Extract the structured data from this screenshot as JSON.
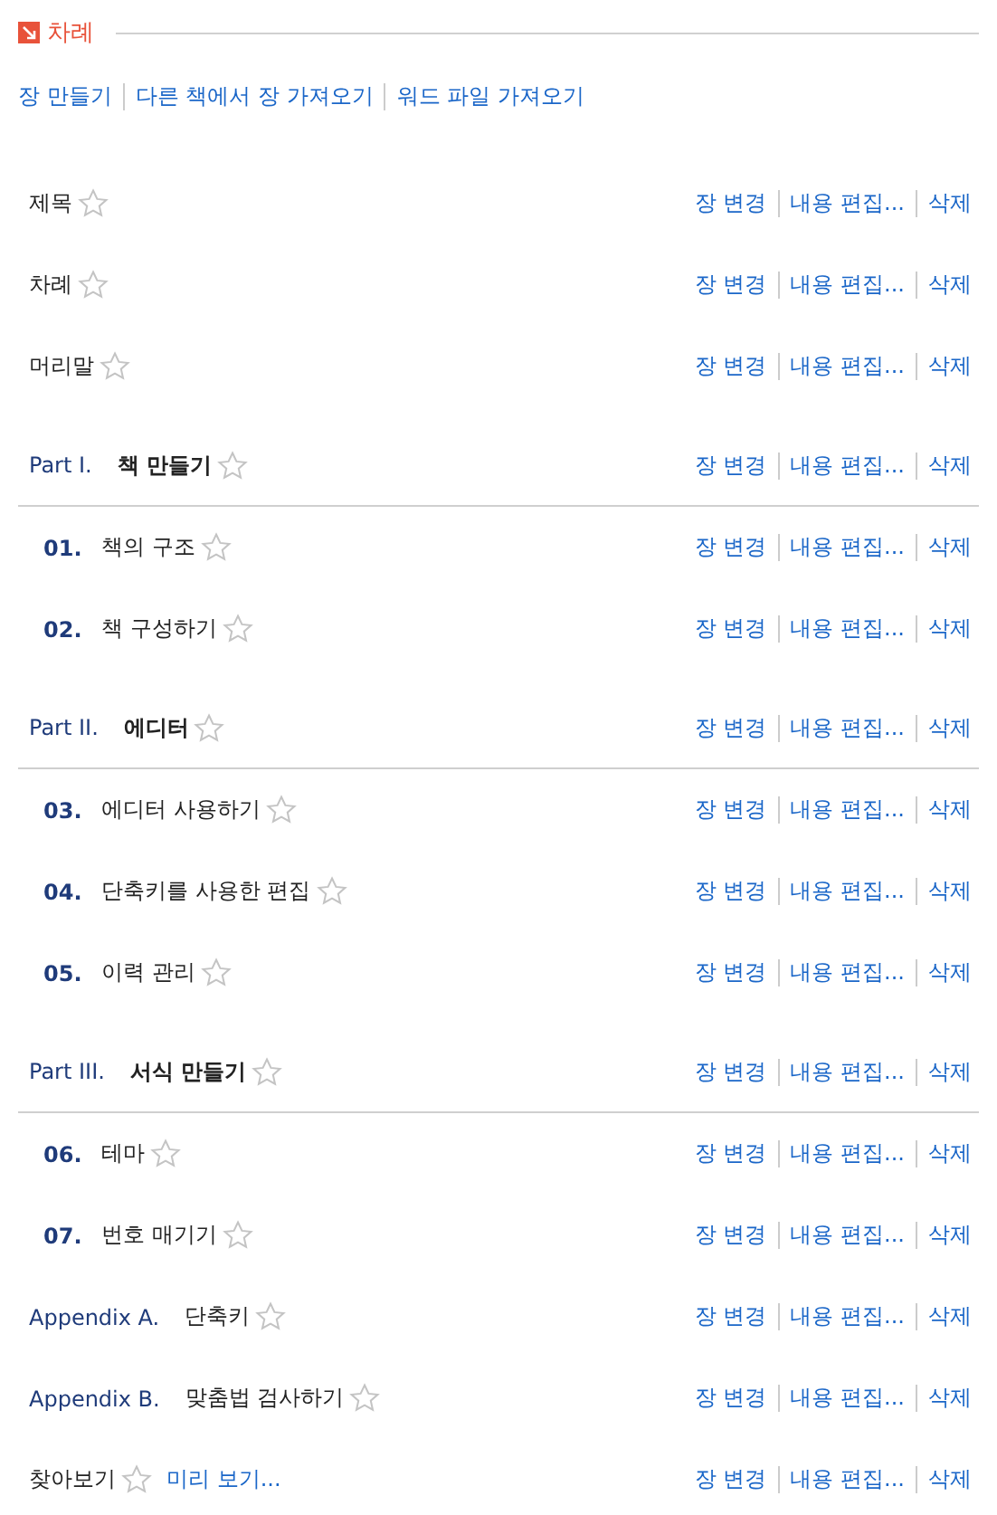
{
  "header": {
    "title": "차례"
  },
  "toolbar": [
    "장 만들기",
    "다른 책에서 장 가져오기",
    "워드 파일 가져오기"
  ],
  "rows": [
    {
      "kind": "plain",
      "title": "제목",
      "starred": false,
      "actions": [
        "장 변경",
        "내용 편집...",
        "삭제"
      ]
    },
    {
      "kind": "plain",
      "title": "차례",
      "starred": false,
      "actions": [
        "장 변경",
        "내용 편집...",
        "삭제"
      ]
    },
    {
      "kind": "plain",
      "title": "머리말",
      "starred": false,
      "actions": [
        "장 변경",
        "내용 편집...",
        "삭제"
      ]
    },
    {
      "kind": "part",
      "label": "Part I.",
      "title": "책 만들기",
      "starred": false,
      "actions": [
        "장 변경",
        "내용 편집...",
        "삭제"
      ]
    },
    {
      "kind": "chapter",
      "label": "01.",
      "title": "책의 구조",
      "starred": false,
      "actions": [
        "장 변경",
        "내용 편집...",
        "삭제"
      ]
    },
    {
      "kind": "chapter",
      "label": "02.",
      "title": "책 구성하기",
      "starred": false,
      "actions": [
        "장 변경",
        "내용 편집...",
        "삭제"
      ]
    },
    {
      "kind": "part",
      "label": "Part II.",
      "title": "에디터",
      "starred": false,
      "actions": [
        "장 변경",
        "내용 편집...",
        "삭제"
      ]
    },
    {
      "kind": "chapter",
      "label": "03.",
      "title": "에디터 사용하기",
      "starred": false,
      "actions": [
        "장 변경",
        "내용 편집...",
        "삭제"
      ]
    },
    {
      "kind": "chapter",
      "label": "04.",
      "title": "단축키를 사용한 편집",
      "starred": false,
      "actions": [
        "장 변경",
        "내용 편집...",
        "삭제"
      ]
    },
    {
      "kind": "chapter",
      "label": "05.",
      "title": "이력 관리",
      "starred": false,
      "actions": [
        "장 변경",
        "내용 편집...",
        "삭제"
      ]
    },
    {
      "kind": "part",
      "label": "Part III.",
      "title": "서식 만들기",
      "starred": false,
      "actions": [
        "장 변경",
        "내용 편집...",
        "삭제"
      ]
    },
    {
      "kind": "chapter",
      "label": "06.",
      "title": "테마",
      "starred": false,
      "actions": [
        "장 변경",
        "내용 편집...",
        "삭제"
      ]
    },
    {
      "kind": "chapter",
      "label": "07.",
      "title": "번호 매기기",
      "starred": false,
      "actions": [
        "장 변경",
        "내용 편집...",
        "삭제"
      ]
    },
    {
      "kind": "appendix",
      "label": "Appendix A.",
      "title": "단축키",
      "starred": false,
      "actions": [
        "장 변경",
        "내용 편집...",
        "삭제"
      ]
    },
    {
      "kind": "appendix",
      "label": "Appendix B.",
      "title": "맞춤법 검사하기",
      "starred": false,
      "actions": [
        "장 변경",
        "내용 편집...",
        "삭제"
      ]
    },
    {
      "kind": "plain",
      "title": "찾아보기",
      "starred": false,
      "preview": "미리 보기...",
      "actions": [
        "장 변경",
        "내용 편집...",
        "삭제"
      ]
    }
  ]
}
